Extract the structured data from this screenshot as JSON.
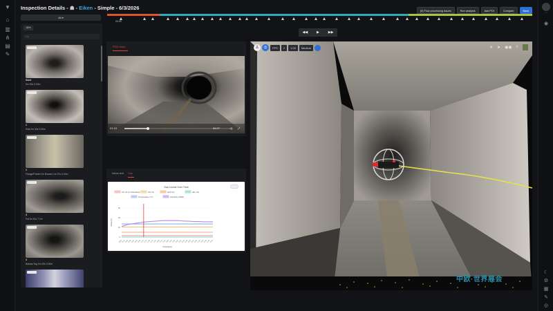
{
  "header": {
    "title_prefix": "Inspection Details - ",
    "title_link": "Eiken",
    "title_suffix": " - Simple - 6/3/2026",
    "buttons": {
      "flow_processing": "(0) Flow processing issues",
      "run_analysis": "Run analysis",
      "add_poi": "Add POI",
      "compare": "Compare",
      "back": "Back"
    }
  },
  "filter": {
    "all_label": "All",
    "type_label": "All",
    "search_placeholder": "Go"
  },
  "timeline": {
    "label": "00:00",
    "colors": {
      "segment1": "#e0542a",
      "segment2": "#27b0b9",
      "segment3": "#a8c83a"
    }
  },
  "thumbnails": [
    {
      "number": "Start",
      "caption": "0m 00s 0.00m"
    },
    {
      "number": "1",
      "caption": "Start fm 40s 0.00m"
    },
    {
      "number": "2",
      "caption": "Flange/Pointer fm Bowser 1m 37s 0.00m"
    },
    {
      "number": "3",
      "caption": "Fat fm 43s 7.7m"
    },
    {
      "number": "4",
      "caption": "Balsan/Tag 2m 43s 0.00m"
    },
    {
      "number": "5",
      "caption": ""
    }
  ],
  "video": {
    "tab_label": "POD video",
    "current_time": "01:10",
    "duration": "06:27",
    "progress": 0.22
  },
  "chart_tabs": {
    "tab1": "Inflow test",
    "tab2": "Gas"
  },
  "chart_data": {
    "type": "line",
    "title": "Gas Levels Over Time",
    "xlabel": "Timestamp",
    "ylabel": "Value (%)",
    "ylim": [
      0,
      60
    ],
    "categories": [
      "0:00",
      "0:10",
      "0:20",
      "0:30",
      "0:40",
      "0:50",
      "1:00",
      "1:10",
      "1:20",
      "1:30",
      "1:40",
      "1:50",
      "2:00",
      "2:10",
      "2:20",
      "2:30",
      "2:40",
      "2:50",
      "3:00",
      "3:10",
      "3:20",
      "3:30",
      "3:40",
      "3:50",
      "4:00",
      "4:10",
      "4:20",
      "4:30",
      "4:40",
      "4:50"
    ],
    "series": [
      {
        "name": "CO (% for Saturation)",
        "color": "#e8a0a0",
        "values": [
          3,
          3,
          3,
          3,
          3,
          3,
          3,
          3,
          3,
          3,
          3,
          3,
          3,
          3,
          3,
          3,
          3,
          3,
          3,
          3,
          3,
          3,
          3,
          3,
          3,
          3,
          3,
          3,
          3,
          3
        ]
      },
      {
        "name": "O2 (%)",
        "color": "#f0c070",
        "values": [
          20.9,
          20.9,
          20.9,
          20.9,
          20.9,
          20.9,
          20.9,
          20.9,
          20.9,
          20.9,
          20.9,
          20.9,
          20.9,
          20.9,
          20.9,
          20.9,
          20.9,
          20.9,
          20.9,
          20.9,
          20.9,
          20.9,
          20.9,
          20.9,
          20.9,
          20.9,
          20.9,
          20.9,
          20.9,
          20.9
        ]
      },
      {
        "name": "H2S (%)",
        "color": "#f0a878",
        "values": [
          10,
          10,
          10,
          10,
          10,
          10,
          10,
          10,
          10,
          10,
          10,
          10,
          10,
          10,
          10,
          10,
          10,
          10,
          10,
          10,
          10,
          10,
          10,
          10,
          10,
          10,
          10,
          10,
          10,
          10
        ]
      },
      {
        "name": "LEL (%)",
        "color": "#7dd0c8",
        "values": [
          0,
          0,
          0,
          0,
          0,
          0,
          0,
          0,
          0,
          0,
          0,
          0,
          0,
          0,
          0,
          0,
          0,
          0,
          0,
          0,
          0,
          0,
          0,
          0,
          0,
          0,
          0,
          0,
          0,
          0
        ]
      },
      {
        "name": "Temperature (°C)",
        "color": "#8ab4e8",
        "values": [
          27,
          27,
          27,
          27,
          27,
          27,
          27,
          27,
          27,
          27,
          27,
          27,
          27,
          27,
          27,
          27,
          27,
          27,
          27,
          27,
          27,
          27,
          27,
          27,
          27,
          27,
          27,
          27,
          27,
          27
        ]
      },
      {
        "name": "Humidity (%RH)",
        "color": "#b38ae8",
        "values": [
          22,
          24,
          26,
          27,
          28,
          29,
          30,
          31,
          31.5,
          32,
          32.5,
          33,
          33.5,
          34,
          34,
          34,
          34,
          34,
          34,
          33.5,
          33,
          33,
          32.5,
          32,
          32,
          32,
          31.5,
          31.5,
          31.5,
          31.5
        ]
      }
    ],
    "marker_index": 7
  },
  "viewer": {
    "toolbar": {
      "fps_label": "FPS",
      "fps_value": "2",
      "scale_value": "1.00",
      "quality": "Medium"
    }
  },
  "watermark": "中欧·世界展会"
}
